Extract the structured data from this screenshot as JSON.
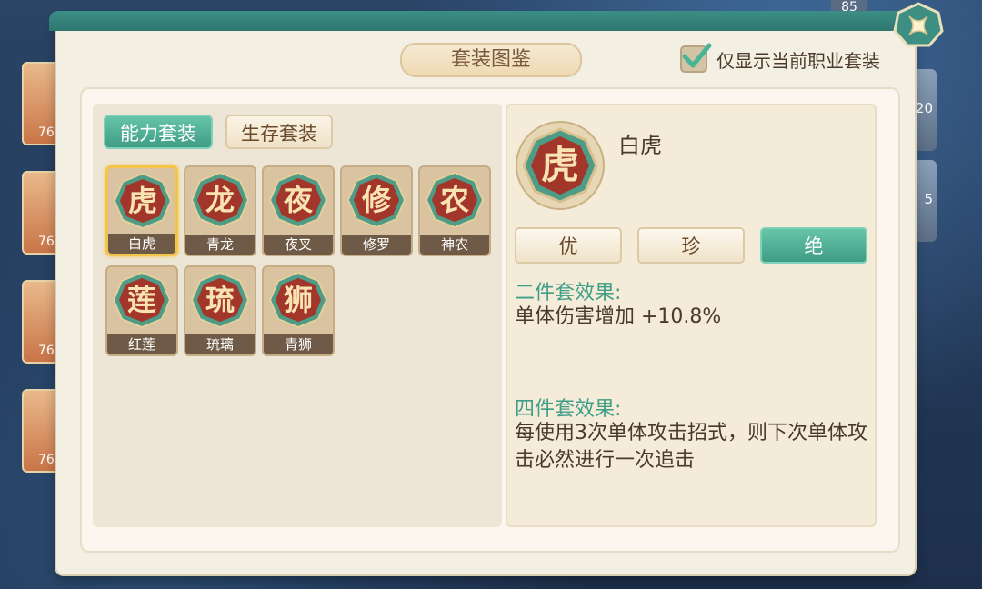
{
  "background": {
    "left_cards": [
      "76",
      "76",
      "76",
      "76"
    ],
    "left_card_tops": [
      "9",
      "9",
      "9",
      "9"
    ],
    "right_card_nums": [
      "20",
      "5"
    ],
    "top_num": "85"
  },
  "panel": {
    "title": "套装图鉴",
    "checkbox_label": "仅显示当前职业套装",
    "checkbox_checked": true
  },
  "tabs": [
    {
      "label": "能力套装",
      "active": true
    },
    {
      "label": "生存套装",
      "active": false
    }
  ],
  "sets": [
    {
      "char": "虎",
      "name": "白虎",
      "selected": true
    },
    {
      "char": "龙",
      "name": "青龙"
    },
    {
      "char": "夜",
      "name": "夜叉"
    },
    {
      "char": "修",
      "name": "修罗"
    },
    {
      "char": "农",
      "name": "神农"
    },
    {
      "char": "莲",
      "name": "红莲"
    },
    {
      "char": "琉",
      "name": "琉璃"
    },
    {
      "char": "狮",
      "name": "青狮"
    }
  ],
  "detail": {
    "char": "虎",
    "name": "白虎",
    "grades": [
      {
        "label": "优",
        "active": false
      },
      {
        "label": "珍",
        "active": false
      },
      {
        "label": "绝",
        "active": true
      }
    ],
    "two_piece_head": "二件套效果:",
    "two_piece_text": "单体伤害增加 +10.8%",
    "four_piece_head": "四件套效果:",
    "four_piece_text": "每使用3次单体攻击招式，则下次单体攻击必然进行一次追击"
  },
  "colors": {
    "accent_green": "#3f9d85",
    "emblem_red": "#a3362a",
    "selected_border": "#f2c54a"
  }
}
